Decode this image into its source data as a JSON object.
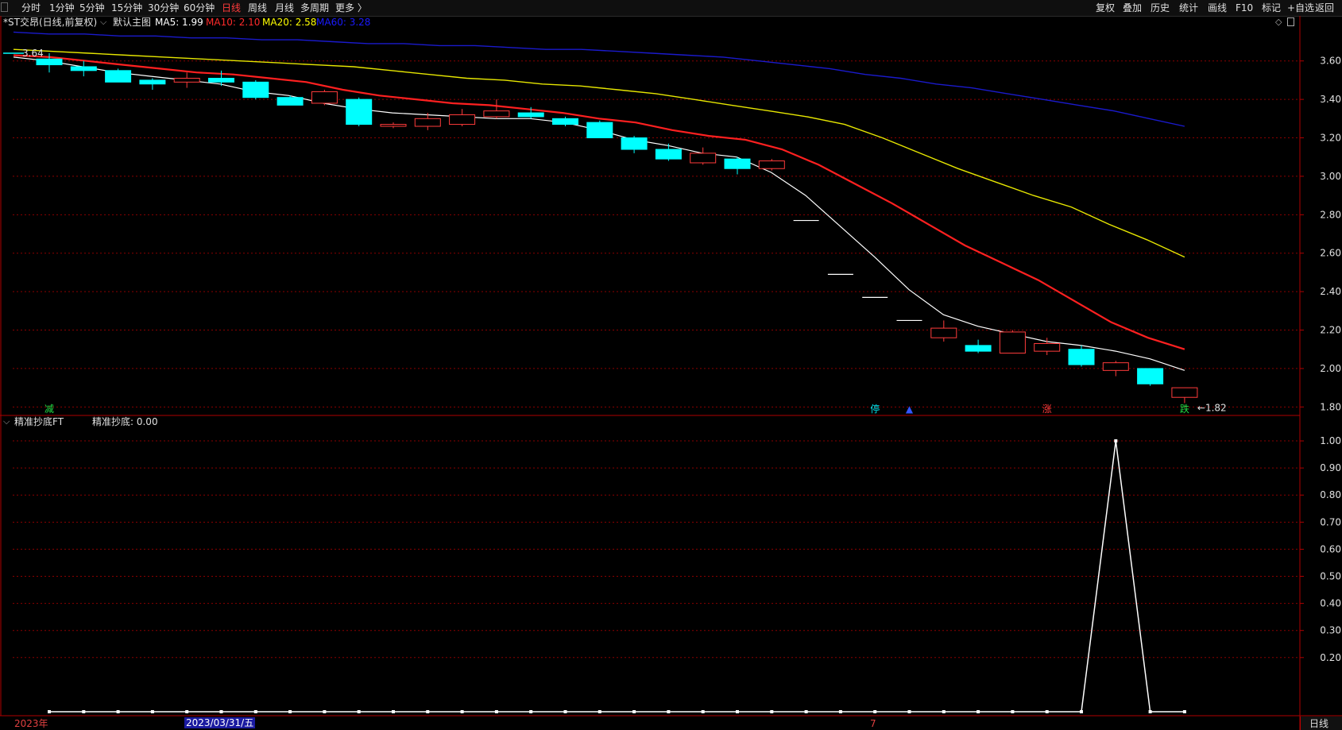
{
  "toolbar": {
    "periods": [
      {
        "label": "分时",
        "active": false
      },
      {
        "label": "1分钟",
        "active": false
      },
      {
        "label": "5分钟",
        "active": false
      },
      {
        "label": "15分钟",
        "active": false
      },
      {
        "label": "30分钟",
        "active": false
      },
      {
        "label": "60分钟",
        "active": false
      },
      {
        "label": "日线",
        "active": true
      },
      {
        "label": "周线",
        "active": false
      },
      {
        "label": "月线",
        "active": false
      },
      {
        "label": "多周期",
        "active": false
      },
      {
        "label": "更多 〉",
        "active": false
      }
    ],
    "right_buttons": [
      "复权",
      "叠加",
      "历史",
      "统计",
      "画线",
      "F10",
      "标记",
      "+自选",
      "返回"
    ]
  },
  "main_chart": {
    "title": "*ST交昂(日线,前复权)",
    "template": "默认主图",
    "ma_legend": [
      {
        "label": "MA5: 1.99",
        "color": "#ffffff"
      },
      {
        "label": "MA10: 2.10",
        "color": "#ff2a2a"
      },
      {
        "label": "MA20: 2.58",
        "color": "#ffff00"
      },
      {
        "label": "MA60: 3.28",
        "color": "#1a1aff"
      }
    ],
    "high_marker": "3.64",
    "low_marker": "←1.82",
    "signals": [
      {
        "text": "减",
        "color": "#22dd44",
        "i": 0
      },
      {
        "text": "停",
        "color": "#00e5ee",
        "i": 24
      },
      {
        "text": "▲",
        "color": "#3355ff",
        "i": 25
      },
      {
        "text": "涨",
        "color": "#ff3b3b",
        "i": 29
      },
      {
        "text": "跌",
        "color": "#22dd44",
        "i": 33
      }
    ]
  },
  "indicator": {
    "title": "精准抄底FT",
    "value_label": "精准抄底: 0.00"
  },
  "x_axis": {
    "labels": [
      "2023年",
      "2023/03/31/五",
      "7"
    ],
    "period_label": "日线"
  },
  "colors": {
    "up": "#ff3b3b",
    "down": "#00ffff",
    "grid": "#8b0000",
    "axis_text": "#e0e0e0"
  },
  "chart_data": [
    {
      "type": "candlestick",
      "ylim": [
        1.76,
        3.76
      ],
      "yticks": [
        "3.60",
        "3.40",
        "3.20",
        "3.00",
        "2.80",
        "2.60",
        "2.40",
        "2.20",
        "2.00",
        "1.80"
      ],
      "candles": [
        {
          "o": 3.61,
          "h": 3.64,
          "l": 3.54,
          "c": 3.58
        },
        {
          "o": 3.57,
          "h": 3.6,
          "l": 3.52,
          "c": 3.55
        },
        {
          "o": 3.55,
          "h": 3.56,
          "l": 3.49,
          "c": 3.49
        },
        {
          "o": 3.5,
          "h": 3.51,
          "l": 3.45,
          "c": 3.48
        },
        {
          "o": 3.49,
          "h": 3.54,
          "l": 3.46,
          "c": 3.51
        },
        {
          "o": 3.51,
          "h": 3.55,
          "l": 3.47,
          "c": 3.49
        },
        {
          "o": 3.49,
          "h": 3.5,
          "l": 3.4,
          "c": 3.41
        },
        {
          "o": 3.41,
          "h": 3.42,
          "l": 3.37,
          "c": 3.37
        },
        {
          "o": 3.38,
          "h": 3.45,
          "l": 3.37,
          "c": 3.44
        },
        {
          "o": 3.4,
          "h": 3.41,
          "l": 3.26,
          "c": 3.27
        },
        {
          "o": 3.26,
          "h": 3.28,
          "l": 3.25,
          "c": 3.27
        },
        {
          "o": 3.26,
          "h": 3.33,
          "l": 3.24,
          "c": 3.3
        },
        {
          "o": 3.27,
          "h": 3.35,
          "l": 3.26,
          "c": 3.32
        },
        {
          "o": 3.31,
          "h": 3.4,
          "l": 3.3,
          "c": 3.34
        },
        {
          "o": 3.33,
          "h": 3.36,
          "l": 3.3,
          "c": 3.31
        },
        {
          "o": 3.3,
          "h": 3.31,
          "l": 3.26,
          "c": 3.27
        },
        {
          "o": 3.28,
          "h": 3.29,
          "l": 3.2,
          "c": 3.2
        },
        {
          "o": 3.2,
          "h": 3.21,
          "l": 3.12,
          "c": 3.14
        },
        {
          "o": 3.14,
          "h": 3.17,
          "l": 3.08,
          "c": 3.09
        },
        {
          "o": 3.07,
          "h": 3.15,
          "l": 3.06,
          "c": 3.12
        },
        {
          "o": 3.09,
          "h": 3.1,
          "l": 3.01,
          "c": 3.04
        },
        {
          "o": 3.04,
          "h": 3.09,
          "l": 3.03,
          "c": 3.08
        },
        {
          "o": 2.77,
          "h": 2.77,
          "l": 2.77,
          "c": 2.77
        },
        {
          "o": 2.49,
          "h": 2.49,
          "l": 2.49,
          "c": 2.49
        },
        {
          "o": 2.37,
          "h": 2.37,
          "l": 2.37,
          "c": 2.37
        },
        {
          "o": 2.25,
          "h": 2.25,
          "l": 2.25,
          "c": 2.25
        },
        {
          "o": 2.16,
          "h": 2.25,
          "l": 2.14,
          "c": 2.21
        },
        {
          "o": 2.12,
          "h": 2.15,
          "l": 2.08,
          "c": 2.09
        },
        {
          "o": 2.08,
          "h": 2.2,
          "l": 2.08,
          "c": 2.19
        },
        {
          "o": 2.09,
          "h": 2.16,
          "l": 2.07,
          "c": 2.13
        },
        {
          "o": 2.1,
          "h": 2.12,
          "l": 2.01,
          "c": 2.02
        },
        {
          "o": 1.99,
          "h": 2.04,
          "l": 1.96,
          "c": 2.03
        },
        {
          "o": 2.0,
          "h": 2.0,
          "l": 1.91,
          "c": 1.92
        },
        {
          "o": 1.85,
          "h": 1.9,
          "l": 1.82,
          "c": 1.9
        }
      ],
      "ma": {
        "MA5": [
          3.62,
          3.6,
          3.57,
          3.54,
          3.52,
          3.5,
          3.48,
          3.44,
          3.42,
          3.38,
          3.35,
          3.33,
          3.32,
          3.31,
          3.3,
          3.3,
          3.28,
          3.24,
          3.19,
          3.16,
          3.12,
          3.1,
          3.02,
          2.9,
          2.74,
          2.58,
          2.41,
          2.28,
          2.22,
          2.18,
          2.14,
          2.12,
          2.09,
          2.05,
          1.99
        ],
        "MA10": [
          3.63,
          3.62,
          3.6,
          3.58,
          3.56,
          3.54,
          3.53,
          3.51,
          3.49,
          3.45,
          3.42,
          3.4,
          3.38,
          3.37,
          3.35,
          3.33,
          3.3,
          3.28,
          3.24,
          3.21,
          3.19,
          3.14,
          3.06,
          2.96,
          2.86,
          2.75,
          2.64,
          2.55,
          2.46,
          2.35,
          2.24,
          2.16,
          2.1
        ],
        "MA20": [
          3.66,
          3.65,
          3.64,
          3.63,
          3.62,
          3.61,
          3.6,
          3.59,
          3.58,
          3.57,
          3.55,
          3.53,
          3.51,
          3.5,
          3.48,
          3.47,
          3.45,
          3.43,
          3.4,
          3.37,
          3.34,
          3.31,
          3.27,
          3.2,
          3.12,
          3.04,
          2.97,
          2.9,
          2.84,
          2.75,
          2.67,
          2.58
        ],
        "MA60": [
          3.75,
          3.74,
          3.74,
          3.73,
          3.73,
          3.72,
          3.72,
          3.71,
          3.71,
          3.7,
          3.69,
          3.69,
          3.68,
          3.68,
          3.67,
          3.66,
          3.66,
          3.65,
          3.64,
          3.63,
          3.62,
          3.6,
          3.58,
          3.56,
          3.53,
          3.51,
          3.48,
          3.46,
          3.43,
          3.4,
          3.37,
          3.34,
          3.3,
          3.26
        ]
      }
    },
    {
      "type": "line",
      "name": "精准抄底",
      "ylim": [
        0,
        1.05
      ],
      "yticks": [
        "1.00",
        "0.90",
        "0.80",
        "0.70",
        "0.60",
        "0.50",
        "0.40",
        "0.30",
        "0.20"
      ],
      "values": [
        0,
        0,
        0,
        0,
        0,
        0,
        0,
        0,
        0,
        0,
        0,
        0,
        0,
        0,
        0,
        0,
        0,
        0,
        0,
        0,
        0,
        0,
        0,
        0,
        0,
        0,
        0,
        0,
        0,
        0,
        0,
        1,
        0,
        0
      ]
    }
  ]
}
